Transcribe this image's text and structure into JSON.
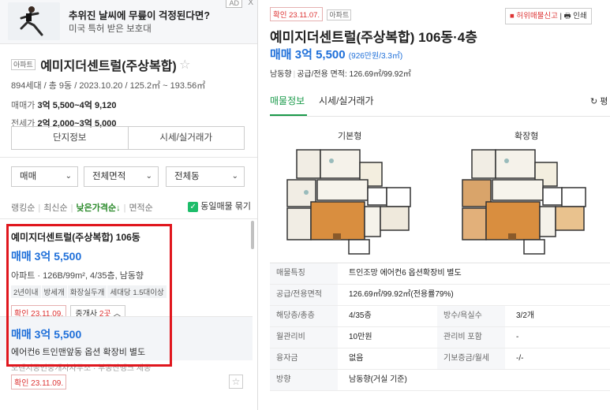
{
  "ad": {
    "headline": "추위진 날씨에 무릎이 걱정된다면?",
    "sub": "미국 특허 받은 보호대",
    "badge": "AD",
    "close": "X"
  },
  "complex": {
    "type_tag": "아파트",
    "name": "예미지더센트럴(주상복합)",
    "star": "☆",
    "meta": "894세대 / 총 9동 / 2023.10.20 / 125.2㎡ ~ 193.56㎡",
    "sale_label": "매매가",
    "sale_value": "3억 5,500~4억 9,120",
    "jeonse_label": "전세가",
    "jeonse_value": "2억 2,000~3억 5,000"
  },
  "buttons": {
    "info": "단지정보",
    "market": "시세/실거래가"
  },
  "filters": {
    "trade": "매매",
    "area": "전체면적",
    "dong": "전체동"
  },
  "sorts": {
    "ranking": "랭킹순",
    "latest": "최신순",
    "lowprice": "낮은가격순↓",
    "area": "면적순",
    "same_listing": "동일매물 묶기",
    "check": "✓"
  },
  "listing1": {
    "title": "예미지더센트럴(주상복합) 106동",
    "price": "매매 3억 5,500",
    "spec": "아파트 · 126B/99m², 4/35층, 남동향",
    "chips": [
      "2년이내",
      "방세개",
      "화장실두개",
      "세대당 1.5대이상"
    ],
    "confirm": "확인 23.11.09.",
    "agents_label": "중개사",
    "agents_count": "2곳",
    "agents_chev": "︿"
  },
  "listing2": {
    "price": "매매 3억 5,500",
    "desc": "에어컨6 트인맨앞동 옵션 확장비 별도",
    "agents": "오렌지공인중개사사무소 · 부동산뱅크 제공",
    "confirm": "확인 23.11.09.",
    "star": "☆"
  },
  "detail": {
    "confirm": "확인 23.11.07.",
    "type_tag": "아파트",
    "report": "■ 허위매물신고",
    "print": "🖶 인쇄",
    "title": "예미지더센트럴(주상복합) 106동·4층",
    "price": "매매 3억 5,500",
    "price_unit": "(926만원/3.3㎡)",
    "direction": "남동향",
    "meta_sep": "|",
    "area_info": "공급/전용 면적: 126.69㎡/99.92㎡",
    "tab_info": "매물정보",
    "tab_market": "시세/실거래가",
    "tab_refresh": "↻ 평",
    "plan_basic": "기본형",
    "plan_expanded": "확장형",
    "rows": [
      {
        "k": "매물특징",
        "v": "트인조망 에어컨6 옵션확장비 별도"
      },
      {
        "k": "공급/전용면적",
        "v": "126.69㎡/99.92㎡(전용률79%)"
      },
      {
        "k": "해당층/총층",
        "v": "4/35층",
        "k2": "방수/욕실수",
        "v2": "3/2개"
      },
      {
        "k": "월관리비",
        "v": "10만원",
        "k2": "관리비 포함",
        "v2": "-"
      },
      {
        "k": "융자금",
        "v": "없음",
        "k2": "기보증금/월세",
        "v2": "-/-"
      },
      {
        "k": "방향",
        "v": "남동향(거실 기준)"
      }
    ]
  },
  "colors": {
    "accent_green": "#1a9a4a",
    "price_blue": "#1e6fd9",
    "highlight_red": "#e0161d"
  }
}
